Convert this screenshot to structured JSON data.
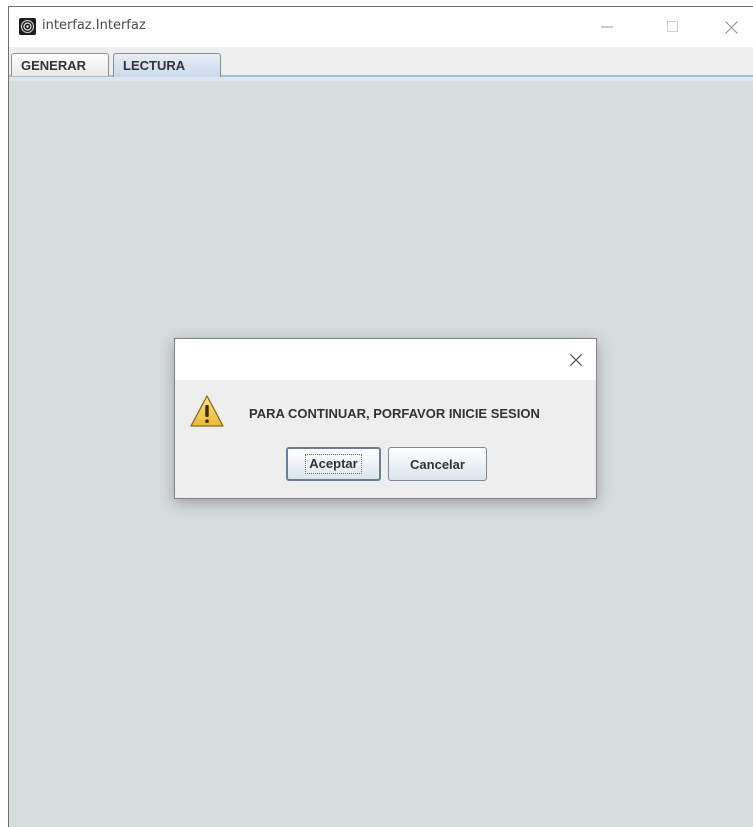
{
  "window": {
    "title": "interfaz.Interfaz",
    "icon": "app-spiral-icon",
    "controls": [
      "minimize-icon",
      "maximize-icon",
      "close-icon"
    ]
  },
  "tabs": [
    {
      "label": "GENERAR",
      "selected": false
    },
    {
      "label": "LECTURA",
      "selected": true
    }
  ],
  "dialog": {
    "icon": "warning-icon",
    "message": "PARA CONTINUAR, PORFAVOR INICIE SESION",
    "accept_label": "Aceptar",
    "cancel_label": "Cancelar"
  },
  "colors": {
    "content_bg": "#d7dcdd",
    "warning_fill": "#f2c94c",
    "selected_tab": "#c9d9ec"
  }
}
